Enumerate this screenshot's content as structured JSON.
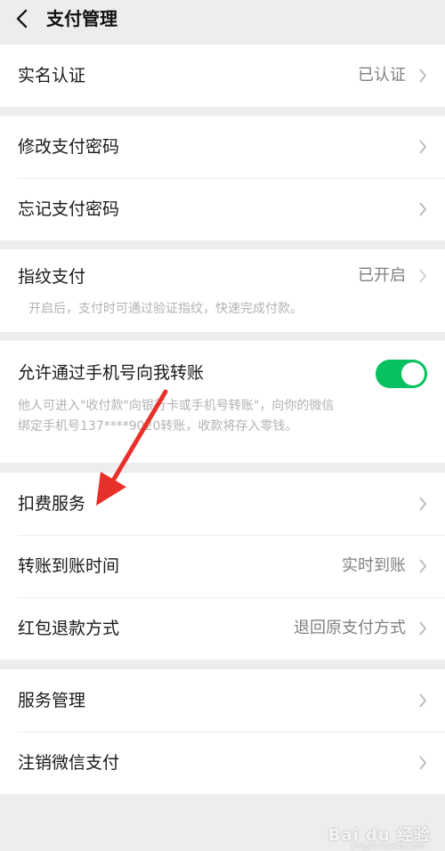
{
  "header": {
    "title": "支付管理"
  },
  "sections": {
    "realname": {
      "label": "实名认证",
      "value": "已认证"
    },
    "password": {
      "change_label": "修改支付密码",
      "forgot_label": "忘记支付密码"
    },
    "fingerprint": {
      "label": "指纹支付",
      "value": "已开启",
      "desc": "开启后，支付时可通过验证指纹，快速完成付款。"
    },
    "phone_transfer": {
      "label": "允许通过手机号向我转账",
      "toggle_on": true,
      "desc_line1": "他人可进入\"收付款\"向银行卡或手机号转账\"，向你的微信",
      "desc_line2": "绑定手机号137****9020转账，收款将存入零钱。"
    },
    "services": {
      "deduction_label": "扣费服务",
      "arrival_label": "转账到账时间",
      "arrival_value": "实时到账",
      "redpacket_label": "红包退款方式",
      "redpacket_value": "退回原支付方式"
    },
    "manage": {
      "service_manage_label": "服务管理",
      "cancel_label": "注销微信支付"
    }
  },
  "colors": {
    "accent": "#07c160",
    "arrow": "#e8302a"
  },
  "watermark": {
    "brand": "Bai du 经验",
    "url": "jingyan.baidu.com"
  }
}
